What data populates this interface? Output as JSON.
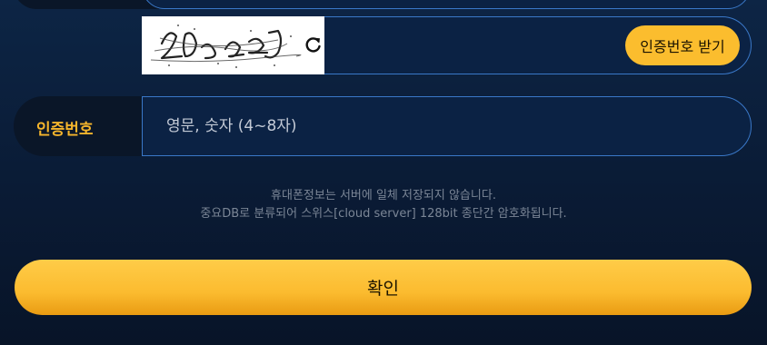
{
  "captcha": {
    "text": "2D2ae",
    "refresh_icon": "refresh-icon",
    "request_button_label": "인증번호 받기",
    "button_color": "#fbbd2e"
  },
  "verification": {
    "label": "인증번호",
    "placeholder": "영문, 숫자 (4~8자)",
    "value": "",
    "label_color": "#f5b52c"
  },
  "notice": {
    "line1": "휴대폰정보는 서버에 일체 저장되지 않습니다.",
    "line2": "중요DB로 분류되어 스위스[cloud server] 128bit 종단간 암호화됩니다."
  },
  "confirm": {
    "label": "확인",
    "color": "#fbbb2f"
  }
}
